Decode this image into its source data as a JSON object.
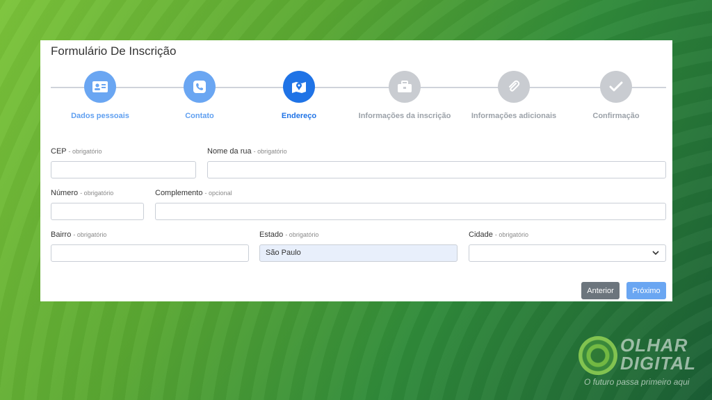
{
  "form": {
    "title": "Formulário De Inscrição",
    "steps": [
      {
        "label": "Dados pessoais",
        "icon": "id-card-icon",
        "state": "done"
      },
      {
        "label": "Contato",
        "icon": "phone-icon",
        "state": "done"
      },
      {
        "label": "Endereço",
        "icon": "map-icon",
        "state": "active"
      },
      {
        "label": "Informações da inscrição",
        "icon": "briefcase-icon",
        "state": "pending"
      },
      {
        "label": "Informações adicionais",
        "icon": "paperclip-icon",
        "state": "pending"
      },
      {
        "label": "Confirmação",
        "icon": "check-icon",
        "state": "pending"
      }
    ],
    "fields": {
      "cep": {
        "label": "CEP",
        "hint": "- obrigatório",
        "value": ""
      },
      "rua": {
        "label": "Nome da rua",
        "hint": "- obrigatório",
        "value": ""
      },
      "numero": {
        "label": "Número",
        "hint": "- obrigatório",
        "value": ""
      },
      "complemento": {
        "label": "Complemento",
        "hint": "- opcional",
        "value": ""
      },
      "bairro": {
        "label": "Bairro",
        "hint": "- obrigatório",
        "value": ""
      },
      "estado": {
        "label": "Estado",
        "hint": "- obrigatório",
        "value": "São Paulo"
      },
      "cidade": {
        "label": "Cidade",
        "hint": "- obrigatório",
        "value": ""
      }
    },
    "buttons": {
      "previous": "Anterior",
      "next": "Próximo"
    }
  },
  "watermark": {
    "brand_line1": "OLHAR",
    "brand_line2": "DIGITAL",
    "tagline": "O futuro passa primeiro aqui"
  },
  "colors": {
    "step_done": "#6aa6f2",
    "step_active": "#1f73e6",
    "step_pending": "#c9ccd1",
    "button_secondary": "#6c757d",
    "button_primary": "#6aa6f2"
  }
}
